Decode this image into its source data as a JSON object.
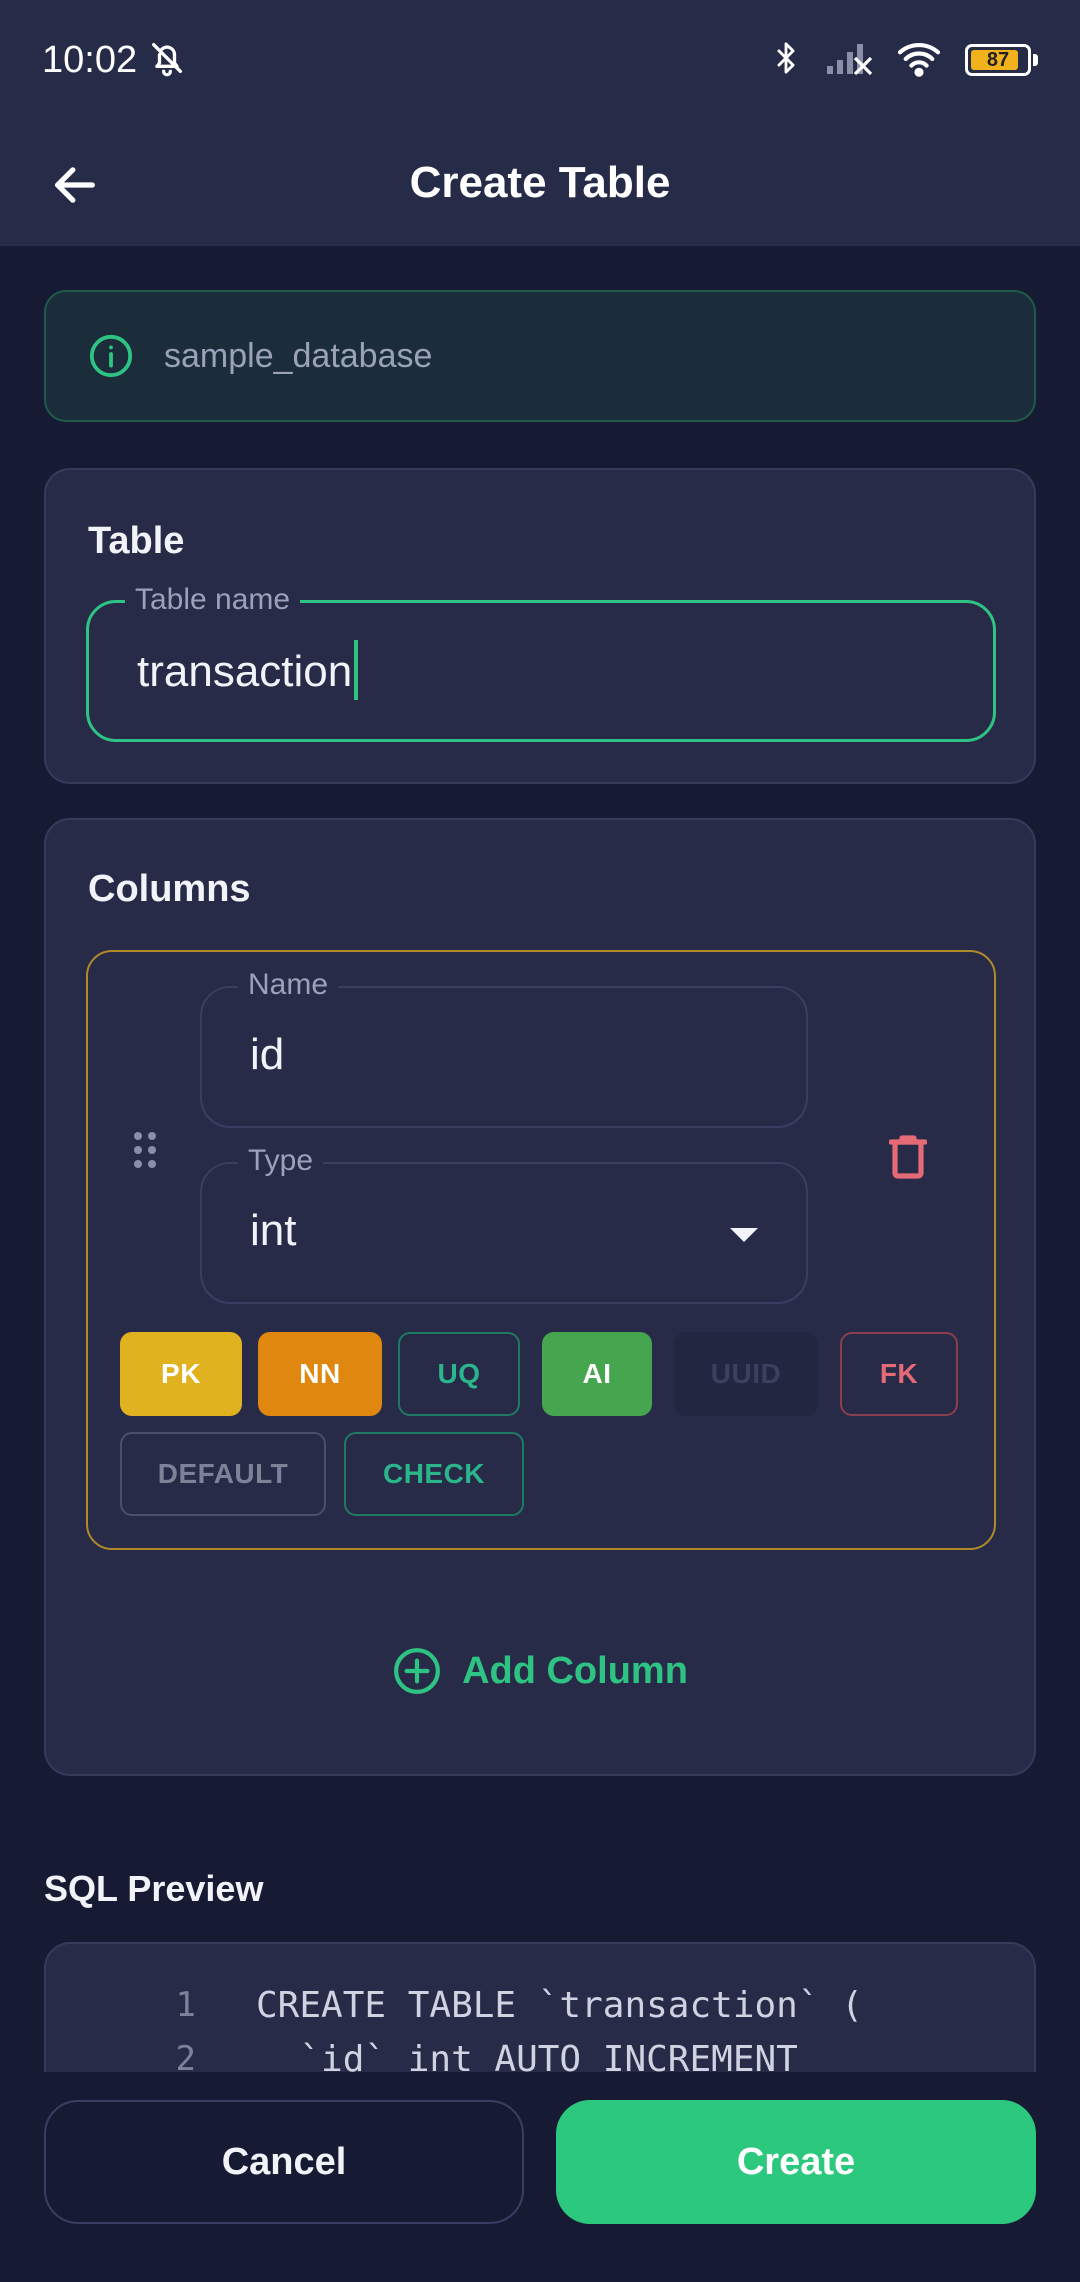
{
  "status_bar": {
    "time": "10:02",
    "battery": "87",
    "icons": [
      "bell-off-icon",
      "bluetooth-icon",
      "signal-icon",
      "wifi-icon",
      "battery-icon"
    ]
  },
  "app_bar": {
    "title": "Create Table",
    "back_icon": "arrow-left-icon"
  },
  "info": {
    "database": "sample_database",
    "icon": "info-icon"
  },
  "table_section": {
    "title": "Table",
    "table_name_label": "Table name",
    "table_name_value": "transaction"
  },
  "columns_section": {
    "title": "Columns",
    "column": {
      "name_label": "Name",
      "name_value": "id",
      "type_label": "Type",
      "type_value": "int",
      "chips": {
        "pk": "PK",
        "nn": "NN",
        "uq": "UQ",
        "ai": "AI",
        "uuid": "UUID",
        "fk": "FK",
        "default": "DEFAULT",
        "check": "CHECK"
      }
    },
    "add_column_label": "Add Column"
  },
  "sql_preview": {
    "title": "SQL Preview",
    "lines": [
      {
        "num": "1",
        "code": "CREATE TABLE `transaction` ("
      },
      {
        "num": "2",
        "code": "  `id` int AUTO_INCREMENT"
      }
    ]
  },
  "actions": {
    "cancel_label": "Cancel",
    "create_label": "Create"
  },
  "colors": {
    "accent": "#2fc383",
    "pk": "#e1b21f",
    "nn": "#e0870f",
    "ai": "#46a650",
    "fk": "#e36a76",
    "background": "#161b33",
    "surface": "#272b48"
  }
}
